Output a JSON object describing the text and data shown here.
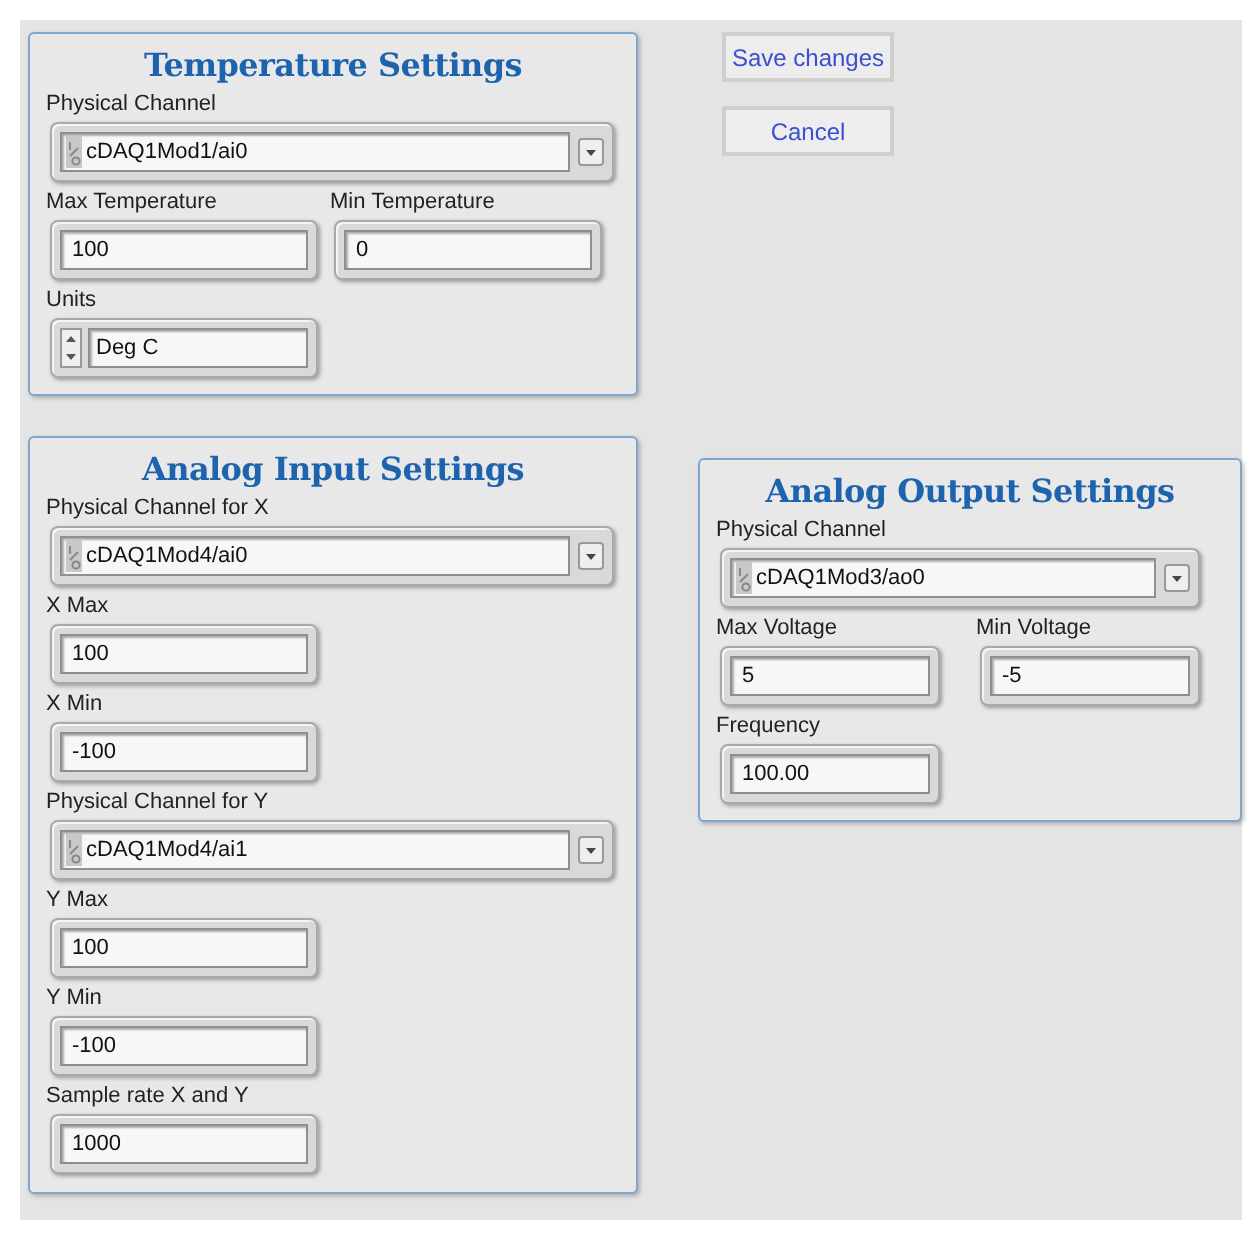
{
  "panels": [
    {
      "title": "Temperature Settings",
      "rows": [
        [
          {
            "kind": "ring",
            "label": "Physical Channel",
            "value": "cDAQ1Mod1/ai0"
          }
        ],
        [
          {
            "kind": "numeric",
            "label": "Max Temperature",
            "value": "100"
          },
          {
            "kind": "numeric",
            "label": "Min Temperature",
            "value": "0"
          }
        ],
        [
          {
            "kind": "enum",
            "label": "Units",
            "value": "Deg C"
          }
        ]
      ]
    },
    {
      "title": "Analog Input Settings",
      "rows": [
        [
          {
            "kind": "ring",
            "label": "Physical Channel for X",
            "value": "cDAQ1Mod4/ai0"
          }
        ],
        [
          {
            "kind": "numeric",
            "label": "X Max",
            "value": "100"
          }
        ],
        [
          {
            "kind": "numeric",
            "label": "X Min",
            "value": "-100"
          }
        ],
        [
          {
            "kind": "ring",
            "label": "Physical Channel for Y",
            "value": "cDAQ1Mod4/ai1"
          }
        ],
        [
          {
            "kind": "numeric",
            "label": "Y Max",
            "value": "100"
          }
        ],
        [
          {
            "kind": "numeric",
            "label": "Y Min",
            "value": "-100"
          }
        ],
        [
          {
            "kind": "numeric",
            "label": "Sample rate X and Y",
            "value": "1000"
          }
        ]
      ]
    },
    {
      "title": "Analog Output Settings",
      "rows": [
        [
          {
            "kind": "ring",
            "label": "Physical Channel",
            "value": "cDAQ1Mod3/ao0"
          }
        ],
        [
          {
            "kind": "numeric",
            "label": "Max Voltage",
            "value": "5"
          },
          {
            "kind": "numeric",
            "label": "Min Voltage",
            "value": "-5"
          }
        ],
        [
          {
            "kind": "numeric",
            "label": "Frequency",
            "value": "100.00"
          }
        ]
      ]
    }
  ],
  "buttons": [
    "Save changes",
    "Cancel"
  ]
}
